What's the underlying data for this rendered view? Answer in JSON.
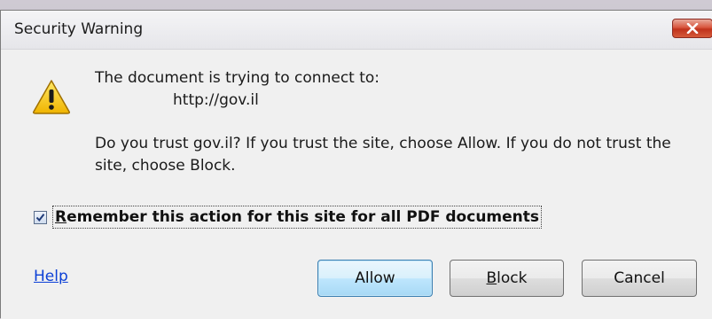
{
  "dialog": {
    "title": "Security Warning",
    "close_icon": "close-x-icon",
    "warning_icon": "warning-triangle-icon",
    "message_line1": "The document is trying to connect to:",
    "url": "http://gov.il",
    "trust_line1": "Do you trust gov.il? If you trust the site, choose Allow. If you do not trust the",
    "trust_line2": "site, choose Block.",
    "remember": {
      "checked": true,
      "label_first": "R",
      "label_rest": "emember this action for this site for all PDF documents"
    },
    "help_link": "Help",
    "buttons": {
      "allow": "Allow",
      "block_first": "B",
      "block_rest": "lock",
      "cancel": "Cancel"
    }
  },
  "colors": {
    "close_button": "#c0321c",
    "link": "#0b3fd6",
    "default_button_border": "#3c7fb1",
    "warning_yellow": "#f5c400"
  }
}
